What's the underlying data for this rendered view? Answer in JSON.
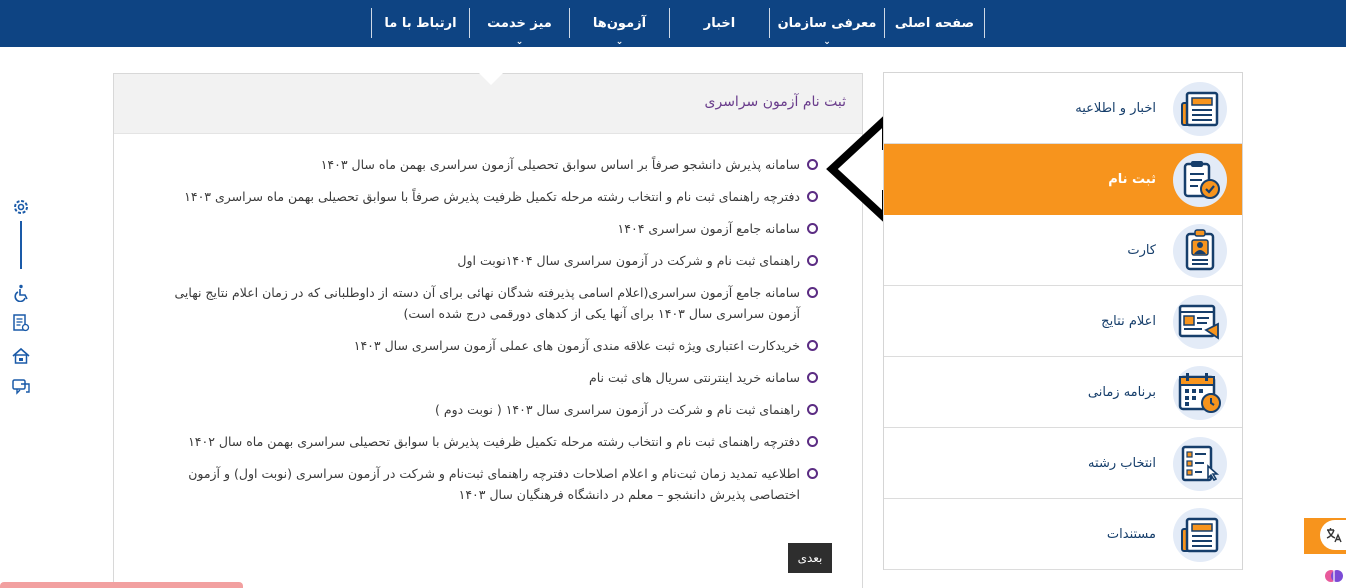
{
  "nav": {
    "items": [
      {
        "label": "صفحه اصلی",
        "dropdown": false
      },
      {
        "label": "معرفی سازمان",
        "dropdown": true
      },
      {
        "label": "اخبار",
        "dropdown": false
      },
      {
        "label": "آزمون‌ها",
        "dropdown": true
      },
      {
        "label": "میز خدمت",
        "dropdown": true
      },
      {
        "label": "ارتباط با ما",
        "dropdown": false
      }
    ]
  },
  "sidemenu": {
    "items": [
      {
        "label": "اخبار و اطلاعیه",
        "icon": "newspaper-icon",
        "active": false
      },
      {
        "label": "ثبت نام",
        "icon": "clipboard-check-icon",
        "active": true
      },
      {
        "label": "کارت",
        "icon": "id-card-icon",
        "active": false
      },
      {
        "label": "اعلام نتایج",
        "icon": "results-announcement-icon",
        "active": false
      },
      {
        "label": "برنامه زمانی",
        "icon": "calendar-clock-icon",
        "active": false
      },
      {
        "label": "انتخاب رشته",
        "icon": "checklist-select-icon",
        "active": false
      },
      {
        "label": "مستندات",
        "icon": "documents-icon",
        "active": false
      }
    ]
  },
  "panel": {
    "title": "ثبت نام آزمون سراسری",
    "links": [
      "سامانه پذیرش دانشجو صرفاً بر اساس سوابق تحصیلی آزمون سراسری بهمن ماه سال ۱۴۰۳",
      "دفترچه راهنمای ثبت نام و انتخاب رشته مرحله تکمیل ظرفیت پذیرش صرفاً با سوابق تحصیلی بهمن ماه سراسری ۱۴۰۳",
      "سامانه جامع آزمون سراسری ۱۴۰۴",
      "راهنمای ثبت نام و شرکت در آزمون سراسری سال ۱۴۰۴نوبت اول",
      "سامانه جامع آزمون سراسری(اعلام اسامی پذیرفته شدگان نهائی برای آن دسته از داوطلبانی که در زمان اعلام نتایج نهایی آزمون سراسری سال ۱۴۰۳ برای آنها یکی از کدهای دورقمی درج شده است)",
      "خریدکارت اعتباری ویژه ثبت علاقه مندی آزمون های عملی آزمون سراسری سال ۱۴۰۳",
      "سامانه خرید اینترنتی سریال های ثبت نام",
      "راهنمای ثبت نام و شرکت در آزمون سراسری سال ۱۴۰۳ ( نوبت دوم )",
      "دفترچه راهنمای ثبت نام و انتخاب رشته مرحله تکمیل ظرفیت پذیرش با سوابق تحصیلی سراسری بهمن ماه سال ۱۴۰۲",
      "اطلاعیه تمدید زمان ثبت‌نام و اعلام اصلاحات دفترچه راهنمای ثبت‌نام و شرکت در آزمون سراسری (نوبت اول) و آزمون اختصاصی پذیرش دانشجو – معلم در دانشگاه فرهنگیان سال ۱۴۰۳"
    ],
    "next_label": "بعدی"
  },
  "toolbar": {
    "icons": [
      "gear-icon",
      "wheelchair-icon",
      "document-list-icon",
      "home-lock-icon",
      "chat-icon"
    ]
  },
  "colors": {
    "nav_bg": "#0e4483",
    "accent_orange": "#f7941d",
    "title_purple": "#6a3d8c",
    "bullet_purple": "#5b2c83"
  }
}
